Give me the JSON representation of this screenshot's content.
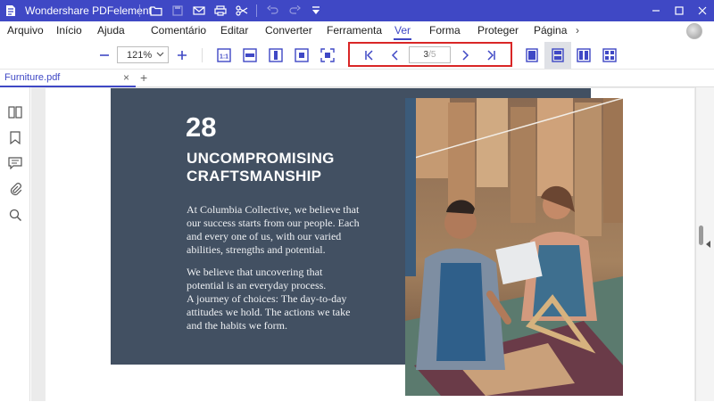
{
  "app": {
    "title": "Wondershare PDFelement"
  },
  "menu": {
    "items": [
      "Arquivo",
      "Início",
      "Ajuda",
      "Comentário",
      "Editar",
      "Converter",
      "Ferramenta",
      "Ver",
      "Forma",
      "Proteger",
      "Página"
    ],
    "active": "Ver"
  },
  "toolbar": {
    "zoom": "121%",
    "page_current": "3",
    "page_total": "/5"
  },
  "tab": {
    "name": "Furniture.pdf",
    "close": "×",
    "add": "+"
  },
  "document": {
    "number": "28",
    "headline": [
      "UNCOMPROMISING",
      "CRAFTSMANSHIP"
    ],
    "paragraph1": [
      "At Columbia Collective, we believe that",
      "our success starts from our people. Each",
      "and every one of us, with our varied",
      "abilities, strengths and potential."
    ],
    "paragraph2": [
      "We believe that uncovering that",
      "potential is an everyday process.",
      "A journey of choices: The day-to-day",
      "attitudes we hold. The actions we take",
      "and the habits we form."
    ]
  },
  "colors": {
    "brand": "#3f48c5",
    "highlight": "#d92626",
    "panel": "#425062"
  }
}
